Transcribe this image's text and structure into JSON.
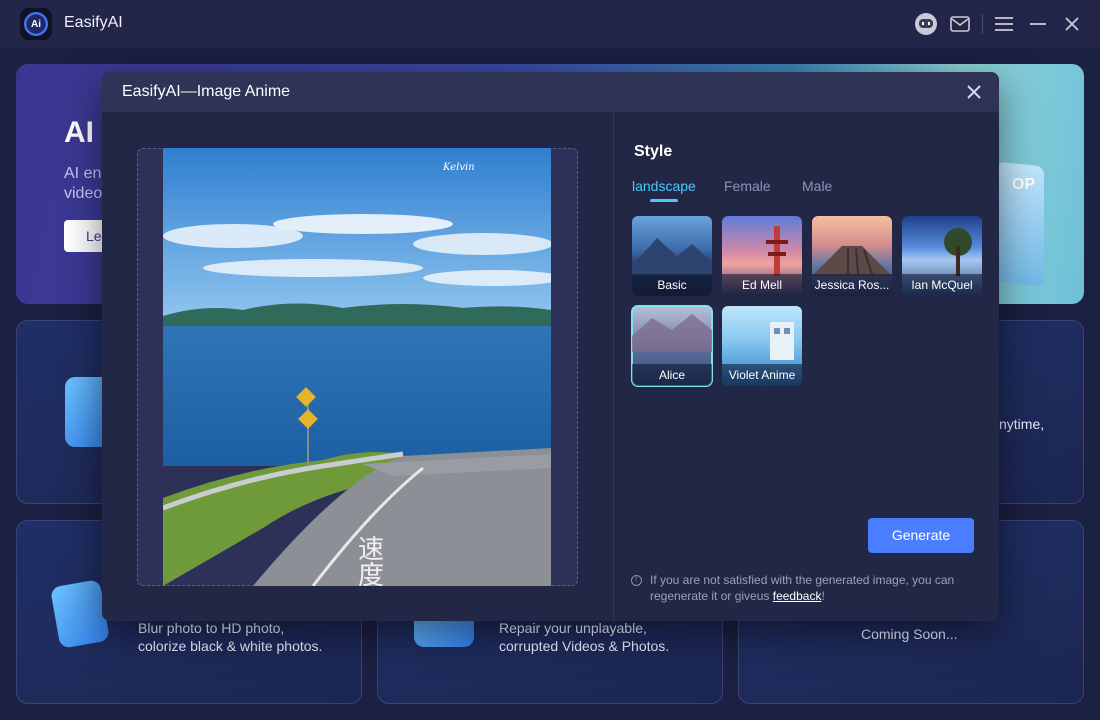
{
  "app": {
    "name": "EasifyAI",
    "logo_text": "Ai"
  },
  "hero": {
    "title": "AI",
    "description": "AI en\nvideo",
    "button": "Le",
    "art_label": "OP"
  },
  "cards": {
    "middle_right_text": "nytime,",
    "bottom_left_text": "Blur photo to HD photo,\ncolorize black & white photos.",
    "bottom_middle_text": "Repair your unplayable,\ncorrupted Videos & Photos.",
    "bottom_right_text": "Coming Soon..."
  },
  "modal": {
    "title": "EasifyAI—Image Anime",
    "style_label": "Style",
    "tabs": [
      "landscape",
      "Female",
      "Male"
    ],
    "active_tab": "landscape",
    "styles": [
      {
        "label": "Basic",
        "selected": false
      },
      {
        "label": "Ed Mell",
        "selected": false
      },
      {
        "label": "Jessica Ros...",
        "selected": false
      },
      {
        "label": "Ian McQuel",
        "selected": false
      },
      {
        "label": "Alice",
        "selected": true
      },
      {
        "label": "Violet Anime",
        "selected": false
      }
    ],
    "generate_button": "Generate",
    "note_text": "If you are not satisfied with the generated image, you can regenerate it or giveus ",
    "note_link": "feedback",
    "note_end": "!",
    "photo_signature": "Kelvin"
  },
  "icons": [
    "robot-icon",
    "mail-icon",
    "menu-icon",
    "minimize-icon",
    "close-icon",
    "info-icon"
  ],
  "colors": {
    "accent": "#4a7dff",
    "tab_active": "#48c8ff",
    "selected_outline": "#7de3e8"
  }
}
